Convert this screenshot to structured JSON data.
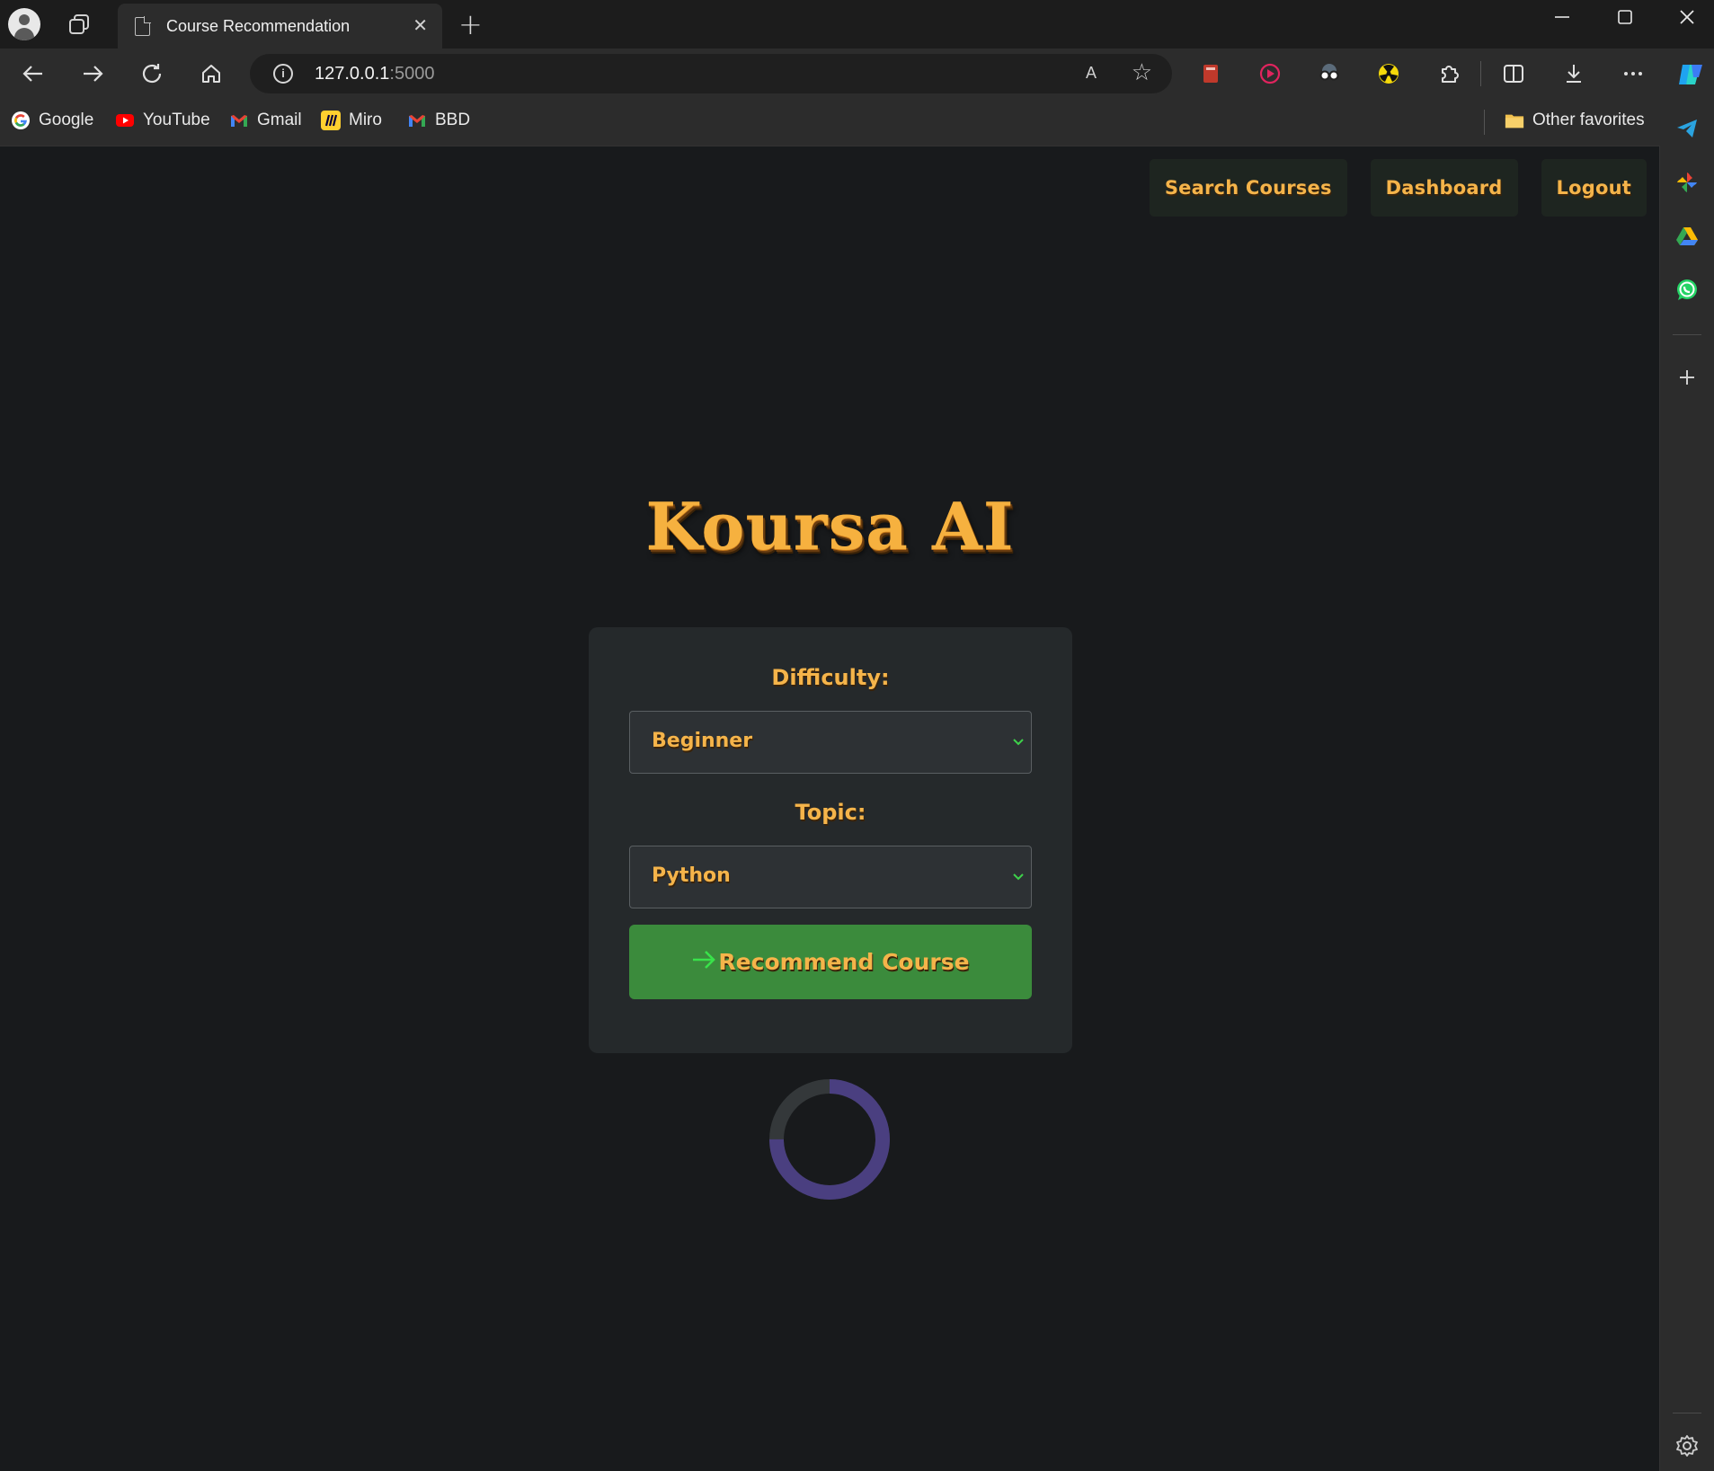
{
  "browser": {
    "tab_title": "Course Recommendation",
    "url_host": "127.0.0.1",
    "url_port": ":5000",
    "read_aloud": "A",
    "bookmarks": [
      {
        "label": "Google",
        "icon": "google-icon"
      },
      {
        "label": "YouTube",
        "icon": "youtube-icon"
      },
      {
        "label": "Gmail",
        "icon": "gmail-icon"
      },
      {
        "label": "Miro",
        "icon": "miro-icon"
      },
      {
        "label": "BBD",
        "icon": "gmail-icon"
      }
    ],
    "other_favorites": "Other favorites"
  },
  "page": {
    "nav": {
      "search": "Search Courses",
      "dashboard": "Dashboard",
      "logout": "Logout"
    },
    "brand": "Koursa AI",
    "form": {
      "difficulty_label": "Difficulty:",
      "difficulty_value": "Beginner",
      "topic_label": "Topic:",
      "topic_value": "Python",
      "submit_label": "Recommend Course",
      "submit_icon": "arrow-right-icon"
    },
    "spinner_progress": 0.25
  },
  "colors": {
    "accent_text": "#f5b44a",
    "button_green": "#3b8b3c",
    "arrow_green": "#39e24a",
    "spinner_track": "#34383a",
    "spinner_arc": "#4a3f80"
  }
}
